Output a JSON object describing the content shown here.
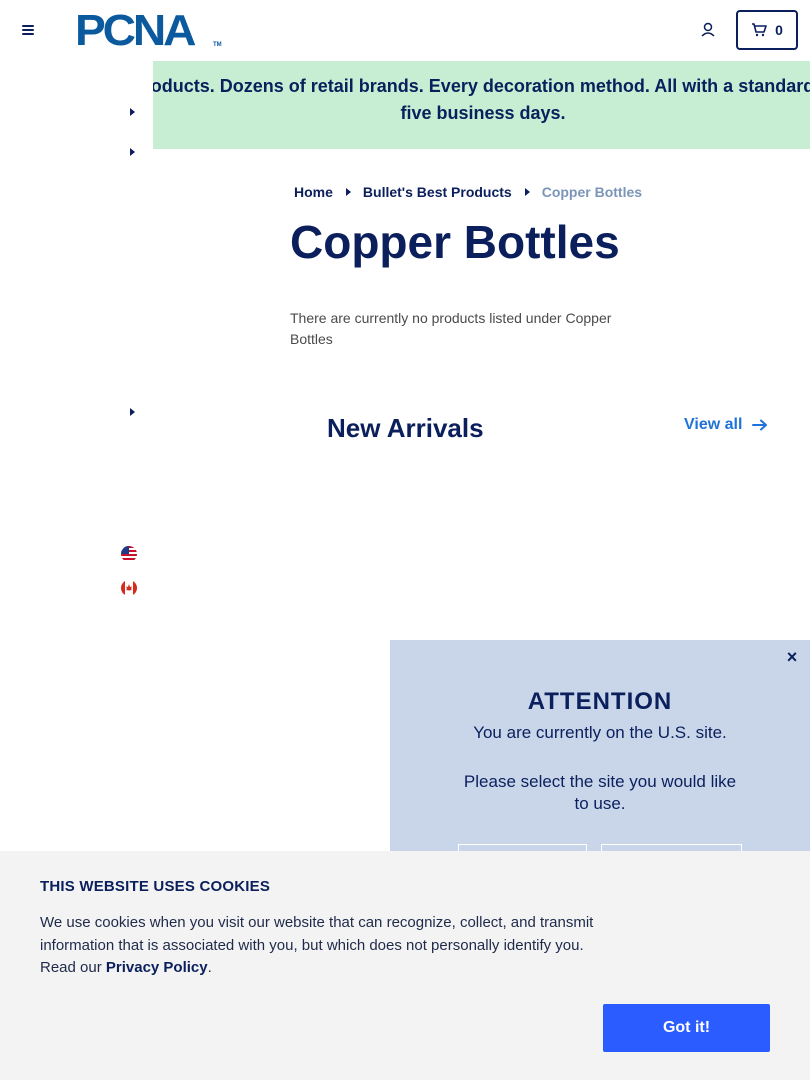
{
  "header": {
    "logo_text": "PCNA",
    "logo_tm": "TM",
    "cart_count": "0"
  },
  "banner": {
    "text": "Thousands of products. Dozens of retail brands. Every decoration method. All with a standard lead time of just five business days."
  },
  "breadcrumb": {
    "home": "Home",
    "category": "Bullet's Best Products",
    "current": "Copper Bottles"
  },
  "page": {
    "title": "Copper Bottles",
    "empty_message": "There are currently no products listed under Copper Bottles"
  },
  "new_arrivals": {
    "heading": "New Arrivals",
    "view_all": "View all"
  },
  "modal": {
    "close": "×",
    "title": "ATTENTION",
    "line1": "You are currently on the U.S. site.",
    "line2": "Please select the site you would like to use."
  },
  "cookie": {
    "title": "THIS WEBSITE USES COOKIES",
    "text": "We use cookies when you visit our website that can recognize, collect, and transmit information that is associated with you, but which does not personally identify you. Read our ",
    "link": "Privacy Policy",
    "after": ".",
    "button": "Got it!"
  },
  "colors": {
    "navy": "#0a1f5c",
    "banner_bg": "#c7eed2",
    "modal_bg": "#c9d6ea",
    "link_blue": "#1f73d6",
    "button_blue": "#2b5cff"
  }
}
